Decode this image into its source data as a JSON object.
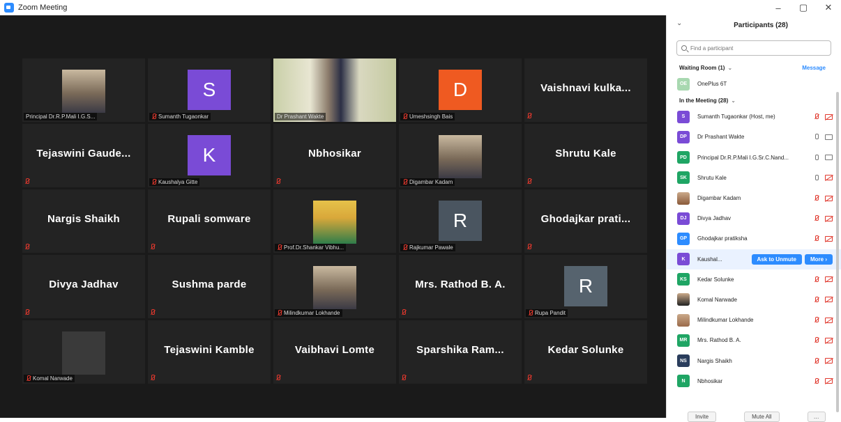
{
  "window": {
    "title": "Zoom Meeting"
  },
  "tiles": [
    {
      "kind": "photo",
      "label": "Principal Dr.R.P.Mali I.G.S...",
      "muted": false
    },
    {
      "kind": "avatar",
      "letter": "S",
      "color": "#7a4bd6",
      "label": "Sumanth Tugaonkar",
      "muted": true
    },
    {
      "kind": "photo",
      "label": "Dr Prashant Wakte",
      "muted": false,
      "active": true
    },
    {
      "kind": "avatar",
      "letter": "D",
      "color": "#ef5a21",
      "label": "Umeshsingh Bais",
      "muted": true
    },
    {
      "kind": "name",
      "name": "Vaishnavi  kulka...",
      "muted": true
    },
    {
      "kind": "name",
      "name": "Tejaswini  Gaude...",
      "muted": true
    },
    {
      "kind": "avatar",
      "letter": "K",
      "color": "#7a4bd6",
      "label": "Kaushalya Gitte",
      "muted": true
    },
    {
      "kind": "name",
      "name": "Nbhosikar",
      "muted": true
    },
    {
      "kind": "photo",
      "label": "Digambar Kadam",
      "muted": true
    },
    {
      "kind": "name",
      "name": "Shrutu Kale",
      "muted": false
    },
    {
      "kind": "name",
      "name": "Nargis Shaikh",
      "muted": true
    },
    {
      "kind": "name",
      "name": "Rupali somware",
      "muted": true
    },
    {
      "kind": "photo",
      "label": "Prof.Dr.Shankar Vibhu...",
      "muted": true
    },
    {
      "kind": "avatar",
      "letter": "R",
      "color": "#4a5560",
      "label": "Rajkumar Pawale",
      "muted": true
    },
    {
      "kind": "name",
      "name": "Ghodajkar  prati...",
      "muted": true
    },
    {
      "kind": "name",
      "name": "Divya Jadhav",
      "muted": true
    },
    {
      "kind": "name",
      "name": "Sushma parde",
      "muted": true
    },
    {
      "kind": "photo",
      "label": "Milindkumar Lokhande",
      "muted": true
    },
    {
      "kind": "name",
      "name": "Mrs. Rathod B. A.",
      "muted": true
    },
    {
      "kind": "avatar",
      "letter": "R",
      "color": "#56636e",
      "label": "Rupa Pandit",
      "muted": true
    },
    {
      "kind": "photo",
      "label": "Komal Narwade",
      "muted": true
    },
    {
      "kind": "name",
      "name": "Tejaswini  Kamble",
      "muted": true
    },
    {
      "kind": "name",
      "name": "Vaibhavi Lomte",
      "muted": true
    },
    {
      "kind": "name",
      "name": "Sparshika  Ram...",
      "muted": true
    },
    {
      "kind": "name",
      "name": "Kedar Solunke",
      "muted": true
    }
  ],
  "panel": {
    "title": "Participants (28)",
    "search_placeholder": "Find a participant",
    "waiting_label": "Waiting Room (1)",
    "message_label": "Message",
    "waiting": [
      {
        "initials": "OE",
        "color": "#a8d8b0",
        "name": "OnePlus 6T"
      }
    ],
    "meeting_label": "In the Meeting (28)",
    "participants": [
      {
        "initials": "S",
        "color": "#7a4bd6",
        "name": "Sumanth Tugaonkar (Host, me)",
        "mic": "off",
        "video": "off"
      },
      {
        "initials": "DP",
        "color": "#7a4bd6",
        "name": "Dr Prashant Wakte",
        "mic": "on",
        "video": "on"
      },
      {
        "initials": "PD",
        "color": "#1fa564",
        "name": "Principal Dr.R.P.Mali I.G.Sr.C.Nand...",
        "mic": "on",
        "video": "on"
      },
      {
        "initials": "SK",
        "color": "#1fa564",
        "name": "Shrutu Kale",
        "mic": "on",
        "video": "off"
      },
      {
        "initials": "",
        "color": "#8a5a3a",
        "name": "Digambar Kadam",
        "mic": "off",
        "video": "off",
        "photo": true
      },
      {
        "initials": "DJ",
        "color": "#7a4bd6",
        "name": "Divya Jadhav",
        "mic": "off",
        "video": "off"
      },
      {
        "initials": "GP",
        "color": "#2d8cff",
        "name": "Ghodajkar pratiksha",
        "mic": "off",
        "video": "off"
      },
      {
        "initials": "K",
        "color": "#7a4bd6",
        "name": "Kaushal...",
        "highlight": true,
        "ask_label": "Ask to Unmute",
        "more_label": "More ›"
      },
      {
        "initials": "KS",
        "color": "#1fa564",
        "name": "Kedar Solunke",
        "mic": "off",
        "video": "off"
      },
      {
        "initials": "",
        "color": "#222",
        "name": "Komal Narwade",
        "mic": "off",
        "video": "off",
        "photo": true
      },
      {
        "initials": "",
        "color": "#9a6a4a",
        "name": "Milindkumar Lokhande",
        "mic": "off",
        "video": "off",
        "photo": true
      },
      {
        "initials": "MR",
        "color": "#1fa564",
        "name": "Mrs. Rathod B. A.",
        "mic": "off",
        "video": "off"
      },
      {
        "initials": "NS",
        "color": "#2a3d5c",
        "name": "Nargis Shaikh",
        "mic": "off",
        "video": "off"
      },
      {
        "initials": "N",
        "color": "#1fa564",
        "name": "Nbhosikar",
        "mic": "off",
        "video": "off"
      }
    ],
    "invite_label": "Invite",
    "mute_all_label": "Mute All"
  }
}
